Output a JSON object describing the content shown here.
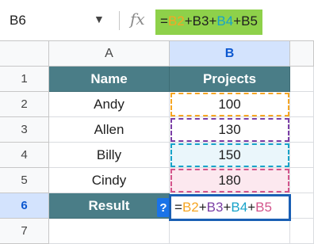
{
  "name_box": {
    "value": "B6",
    "caret": "▼"
  },
  "formula_bar": {
    "fx_label": "fx",
    "parts": [
      {
        "text": "=",
        "color": "#1f1f1f"
      },
      {
        "text": "B2",
        "color": "#f6a623"
      },
      {
        "text": "+B3+",
        "color": "#1f1f1f"
      },
      {
        "text": "B4",
        "color": "#17a3c9"
      },
      {
        "text": "+B5",
        "color": "#1f1f1f"
      }
    ]
  },
  "columns": [
    "A",
    "B"
  ],
  "rows": [
    "1",
    "2",
    "3",
    "4",
    "5",
    "6",
    "7"
  ],
  "table": {
    "header": [
      "Name",
      "Projects"
    ],
    "names": [
      "Andy",
      "Allen",
      "Billy",
      "Cindy"
    ],
    "projects": [
      "100",
      "130",
      "150",
      "180"
    ],
    "result_label": "Result"
  },
  "edit_cell": {
    "parts": [
      {
        "text": "=",
        "color": "#1f1f1f"
      },
      {
        "text": "B2",
        "color": "#f6a623"
      },
      {
        "text": "+",
        "color": "#1f1f1f"
      },
      {
        "text": "B3",
        "color": "#7b3fa6"
      },
      {
        "text": "+",
        "color": "#1f1f1f"
      },
      {
        "text": "B4",
        "color": "#17a3c9"
      },
      {
        "text": "+",
        "color": "#1f1f1f"
      },
      {
        "text": "B5",
        "color": "#d3558c"
      }
    ]
  },
  "help_badge": "?",
  "colors": {
    "header_fill": "#4a7d87",
    "selection": "#1a5fb4",
    "formula_highlight": "#8ed14a"
  }
}
